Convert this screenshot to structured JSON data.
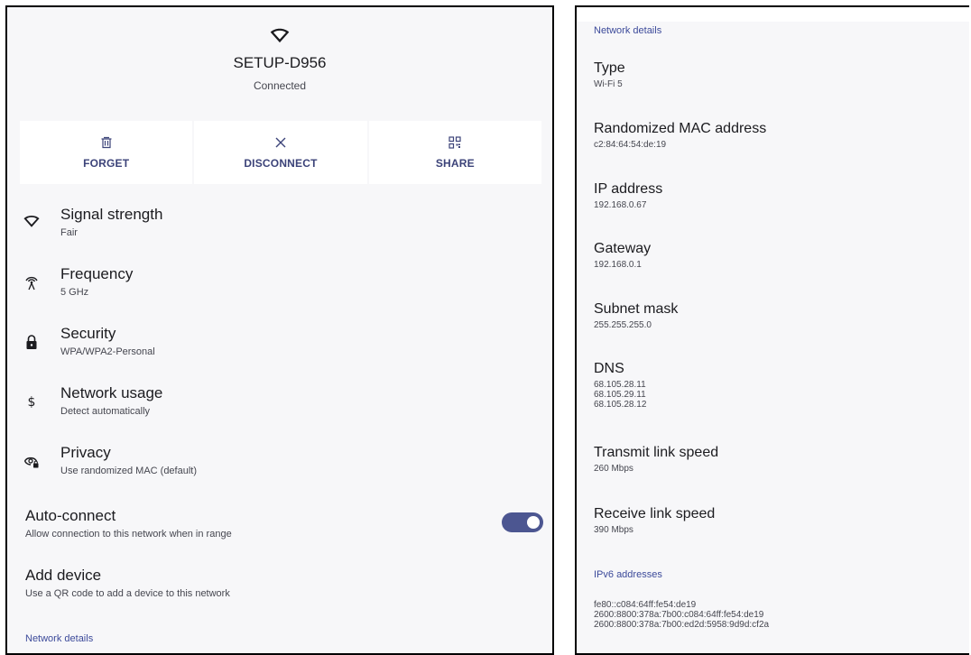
{
  "network": {
    "name": "SETUP-D956",
    "status": "Connected"
  },
  "actions": [
    {
      "label": "FORGET",
      "icon": "trash-icon"
    },
    {
      "label": "DISCONNECT",
      "icon": "close-icon"
    },
    {
      "label": "SHARE",
      "icon": "qr-code-icon"
    }
  ],
  "rows": {
    "signal": {
      "title": "Signal strength",
      "value": "Fair"
    },
    "frequency": {
      "title": "Frequency",
      "value": "5 GHz"
    },
    "security": {
      "title": "Security",
      "value": "WPA/WPA2-Personal"
    },
    "usage": {
      "title": "Network usage",
      "value": "Detect automatically"
    },
    "privacy": {
      "title": "Privacy",
      "value": "Use randomized MAC (default)"
    }
  },
  "auto_connect": {
    "title": "Auto-connect",
    "description": "Allow connection to this network when in range",
    "enabled": true
  },
  "add_device": {
    "title": "Add device",
    "description": "Use a QR code to add a device to this network"
  },
  "left_section_label": "Network details",
  "details": {
    "section_label": "Network details",
    "type": {
      "title": "Type",
      "value": "Wi-Fi 5"
    },
    "mac": {
      "title": "Randomized MAC address",
      "value": "c2:84:64:54:de:19"
    },
    "ip": {
      "title": "IP address",
      "value": "192.168.0.67"
    },
    "gateway": {
      "title": "Gateway",
      "value": "192.168.0.1"
    },
    "subnet": {
      "title": "Subnet mask",
      "value": "255.255.255.0"
    },
    "dns": {
      "title": "DNS",
      "value": "68.105.28.11\n68.105.29.11\n68.105.28.12"
    },
    "tx": {
      "title": "Transmit link speed",
      "value": "260 Mbps"
    },
    "rx": {
      "title": "Receive link speed",
      "value": "390 Mbps"
    },
    "ipv6_label": "IPv6 addresses",
    "ipv6": [
      "fe80::c084:64ff:fe54:de19",
      "2600:8800:378a:7b00:c084:64ff:fe54:de19",
      "2600:8800:378a:7b00:ed2d:5958:9d9d:cf2a"
    ]
  },
  "colors": {
    "accent": "#3c4a9a",
    "toggle_on": "#4c5691",
    "background": "#f7f7f9"
  }
}
